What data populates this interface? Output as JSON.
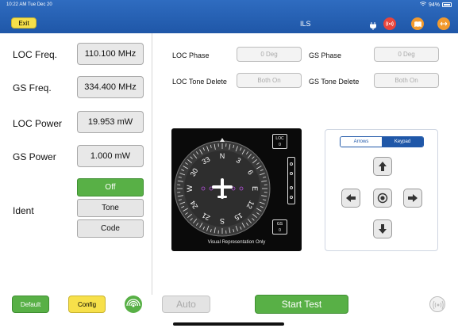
{
  "status": {
    "time": "10:22 AM  Tue Dec 20",
    "battery": "94%"
  },
  "header": {
    "title": "ILS",
    "exit_label": "Exit"
  },
  "left": {
    "loc_freq": {
      "label": "LOC Freq.",
      "value": "110.100 MHz"
    },
    "gs_freq": {
      "label": "GS Freq.",
      "value": "334.400 MHz"
    },
    "loc_power": {
      "label": "LOC Power",
      "value": "19.953 mW"
    },
    "gs_power": {
      "label": "GS Power",
      "value": "1.000 mW"
    },
    "ident": {
      "label": "Ident",
      "options": [
        "Off",
        "Tone",
        "Code"
      ],
      "selected": "Off"
    }
  },
  "params": {
    "loc_phase": {
      "label": "LOC Phase",
      "value": "0 Deg"
    },
    "gs_phase": {
      "label": "GS Phase",
      "value": "0 Deg"
    },
    "loc_tone_delete": {
      "label": "LOC Tone Delete",
      "value": "Both On"
    },
    "gs_tone_delete": {
      "label": "GS Tone Delete",
      "value": "Both On"
    }
  },
  "instrument": {
    "loc_label": "LOC",
    "loc_value": "0",
    "gs_label": "GS",
    "gs_value": "0",
    "caption": "Visual Representation Only",
    "compass": [
      "N",
      "3",
      "6",
      "E",
      "12",
      "15",
      "S",
      "21",
      "24",
      "W",
      "30",
      "33"
    ]
  },
  "pad": {
    "tabs": [
      "Arrows",
      "Keypad"
    ],
    "active_tab": "Arrows"
  },
  "footer": {
    "default_label": "Default",
    "config_label": "Config",
    "auto_label": "Auto",
    "start_label": "Start Test"
  }
}
